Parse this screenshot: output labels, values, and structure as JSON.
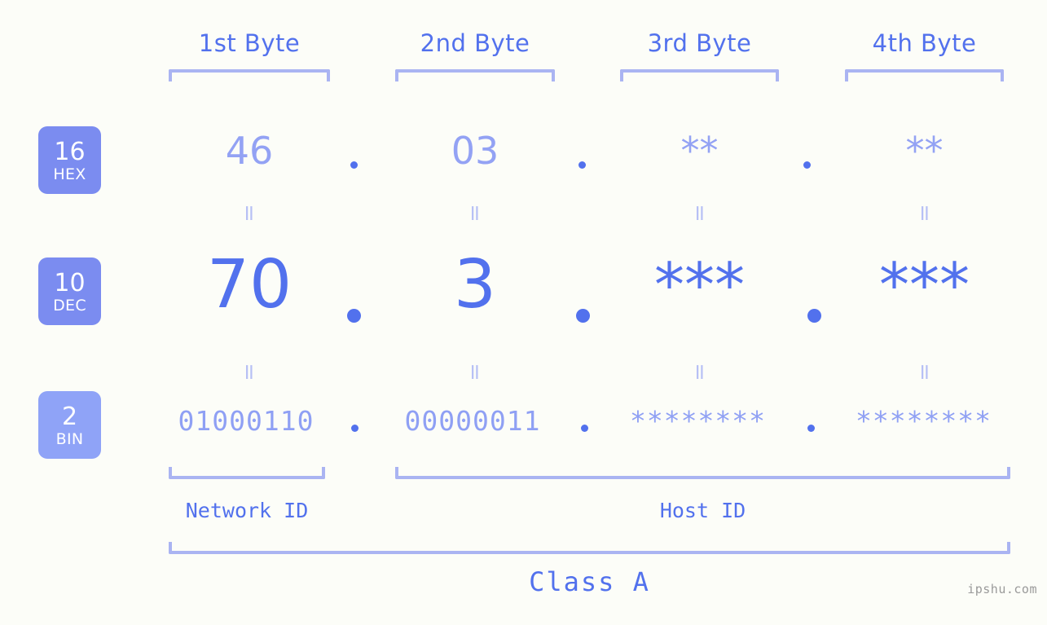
{
  "meta": {
    "background_color": "#fcfdf8",
    "primary_color": "#5271ed",
    "secondary_color": "#93a2f4",
    "bracket_color": "#aab4f2",
    "badge_color": "#7b8cf0",
    "watermark": "ipshu.com"
  },
  "header": {
    "bytes": [
      {
        "label": "1st Byte"
      },
      {
        "label": "2nd Byte"
      },
      {
        "label": "3rd Byte"
      },
      {
        "label": "4th Byte"
      }
    ]
  },
  "rows": [
    {
      "id": "hex",
      "badge_num": "16",
      "badge_sys": "HEX",
      "values": [
        "46",
        "03",
        "**",
        "**"
      ],
      "separator": "."
    },
    {
      "id": "dec",
      "badge_num": "10",
      "badge_sys": "DEC",
      "values": [
        "70",
        "3",
        "***",
        "***"
      ],
      "separator": "."
    },
    {
      "id": "bin",
      "badge_num": "2",
      "badge_sys": "BIN",
      "values": [
        "01000110",
        "00000011",
        "********",
        "********"
      ],
      "separator": "."
    }
  ],
  "connectors": {
    "symbol": "="
  },
  "footer": {
    "network_id_label": "Network ID",
    "host_id_label": "Host ID",
    "class_label": "Class A"
  }
}
